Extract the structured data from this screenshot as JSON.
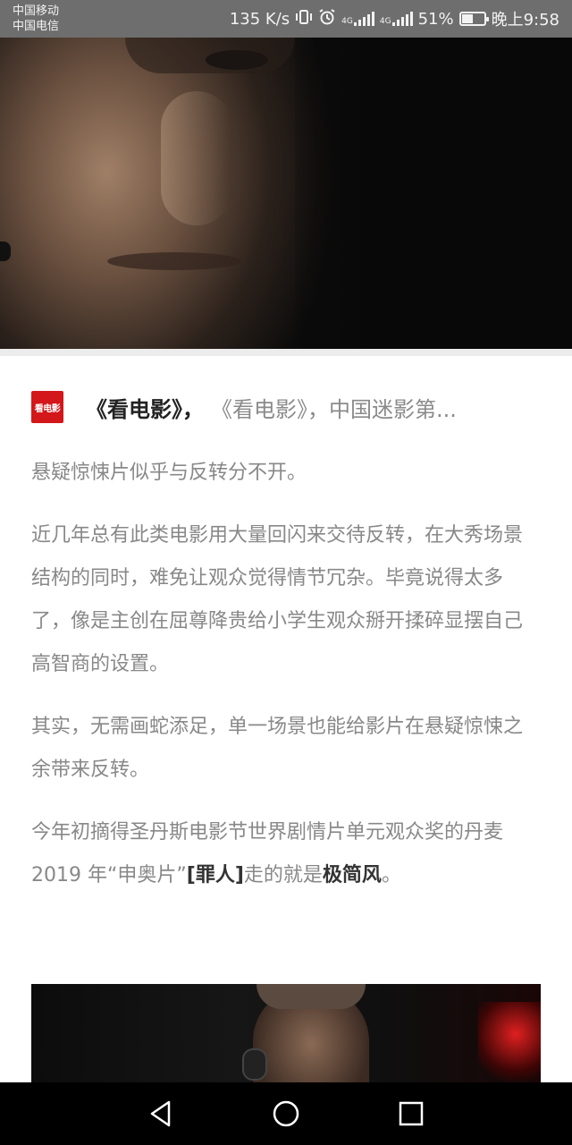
{
  "status_bar": {
    "carrier_1": "中国移动",
    "carrier_2": "中国电信",
    "net_speed": "135 K/s",
    "net_type_1": "4G",
    "net_type_2": "4G",
    "battery_level": "51%",
    "battery_fraction": 0.51,
    "time": "晚上9:58",
    "icons": [
      "vibrate-icon",
      "alarm-icon",
      "signal-icon",
      "signal-icon",
      "battery-icon"
    ]
  },
  "source": {
    "logo_text": "看电影",
    "name": "《看电影》，",
    "description": "《看电影》，中国迷影第..."
  },
  "article": {
    "p1": "悬疑惊悚片似乎与反转分不开。",
    "p2": "近几年总有此类电影用大量回闪来交待反转，在大秀场景结构的同时，难免让观众觉得情节冗杂。毕竟说得太多了，像是主创在屈尊降贵给小学生观众掰开揉碎显摆自己高智商的设置。",
    "p3": "其实，无需画蛇添足，单一场景也能给影片在悬疑惊悚之余带来反转。",
    "p4_start": "今年初摘得圣丹斯电影节世界剧情片单元观众奖的丹麦 2019 年“申奥片”",
    "p4_bold_1": "[罪人]",
    "p4_mid": "走的就是",
    "p4_bold_2": "极简风",
    "p4_end": "。"
  },
  "nav_bar": {
    "buttons": [
      "back-icon",
      "home-icon",
      "recents-icon"
    ]
  }
}
